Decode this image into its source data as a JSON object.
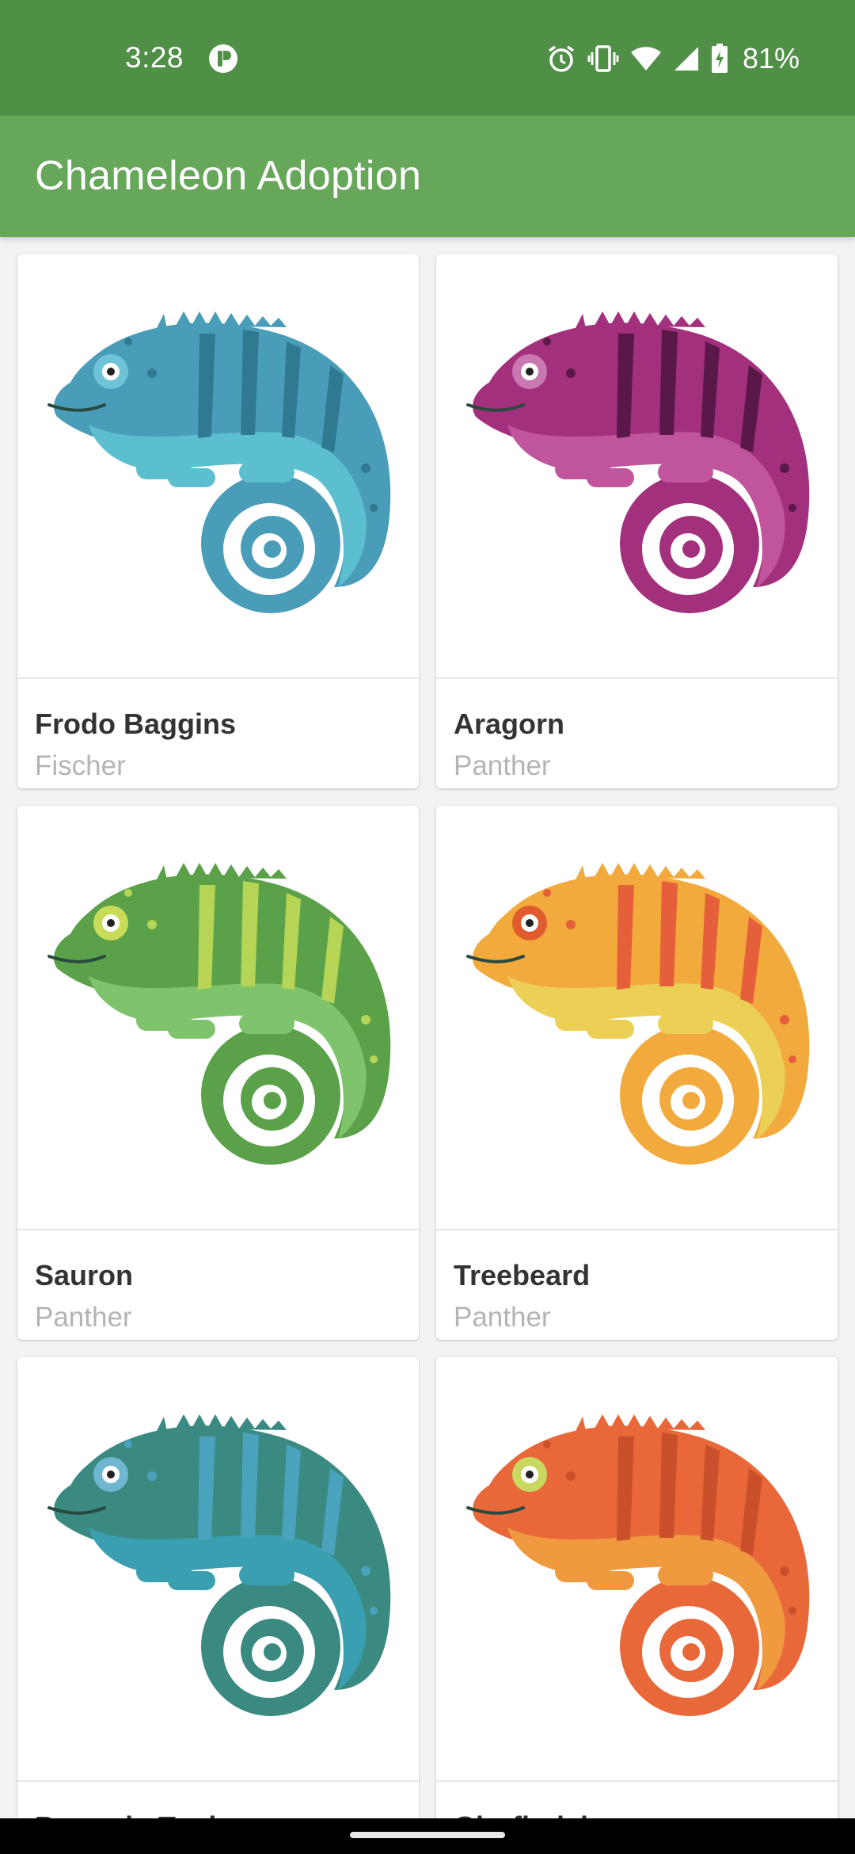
{
  "status_bar": {
    "time": "3:28",
    "battery_percent": "81%",
    "icons": [
      "app-notification-icon",
      "alarm-icon",
      "vibrate-icon",
      "wifi-icon",
      "signal-icon",
      "battery-charging-icon"
    ]
  },
  "app_bar": {
    "title": "Chameleon Adoption",
    "color": "#66a75a"
  },
  "chameleons": [
    {
      "name": "Frodo Baggins",
      "breed": "Fischer",
      "body": "#4a9db8",
      "belly": "#5cbfd0",
      "eye": "#6ec3d6",
      "pattern": "#2f7a90"
    },
    {
      "name": "Aragorn",
      "breed": "Panther",
      "body": "#a3307d",
      "belly": "#c0559d",
      "eye": "#c978b2",
      "pattern": "#5a1848"
    },
    {
      "name": "Sauron",
      "breed": "Panther",
      "body": "#5aa14a",
      "belly": "#7fc46d",
      "eye": "#c8dc5a",
      "pattern": "#b6d455"
    },
    {
      "name": "Treebeard",
      "breed": "Panther",
      "body": "#f2aa3c",
      "belly": "#ecd055",
      "eye": "#e05c2e",
      "pattern": "#e5603a"
    },
    {
      "name": "Peregrin Took",
      "breed": "",
      "body": "#3a8a82",
      "belly": "#3a9fb0",
      "eye": "#6fb6d0",
      "pattern": "#4aa3bd"
    },
    {
      "name": "Glorfindel",
      "breed": "",
      "body": "#e8683a",
      "belly": "#f09a40",
      "eye": "#c8d860",
      "pattern": "#c9502a"
    }
  ]
}
